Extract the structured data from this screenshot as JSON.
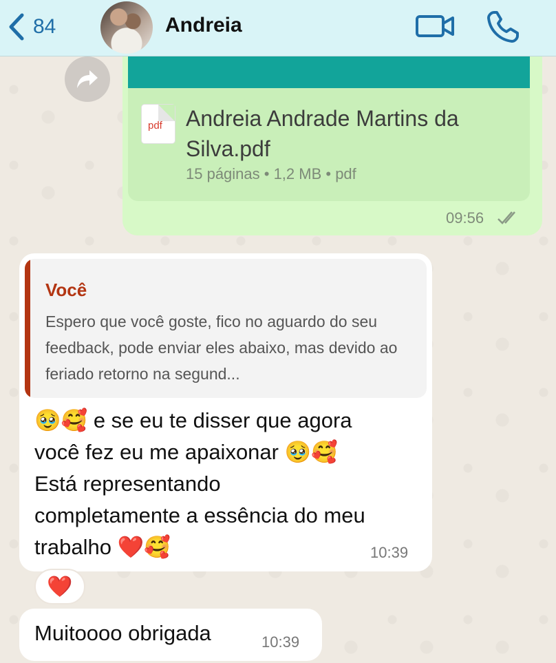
{
  "header": {
    "back_count": "84",
    "contact_name": "Andreia",
    "accent_color": "#1f6ea8",
    "icons": [
      "chevron-left-icon",
      "video-camera-icon",
      "phone-icon"
    ]
  },
  "messages": {
    "document": {
      "icon_label": "pdf",
      "file_name": "Andreia Andrade Martins da Silva.pdf",
      "meta": "15 páginas • 1,2 MB • pdf",
      "time": "09:56",
      "status_icon": "double-check-icon"
    },
    "reply": {
      "quote_author": "Você",
      "quote_text": "Espero que você goste, fico no aguardo do seu feedback, pode enviar eles abaixo, mas devido ao feriado retorno na segund...",
      "line1_text": " e se eu te disser que agora",
      "line2_text": "você fez eu me apaixonar ",
      "line3_text": "Está representando",
      "line4_text": "completamente a essência do meu",
      "line5_text": "trabalho ",
      "emoji_pleading": "🥹",
      "emoji_hearts": "🥰",
      "emoji_heart": "❤️",
      "time": "10:39",
      "reaction": "❤️"
    },
    "thanks": {
      "text": "Muitoooo obrigada",
      "time": "10:39"
    }
  }
}
